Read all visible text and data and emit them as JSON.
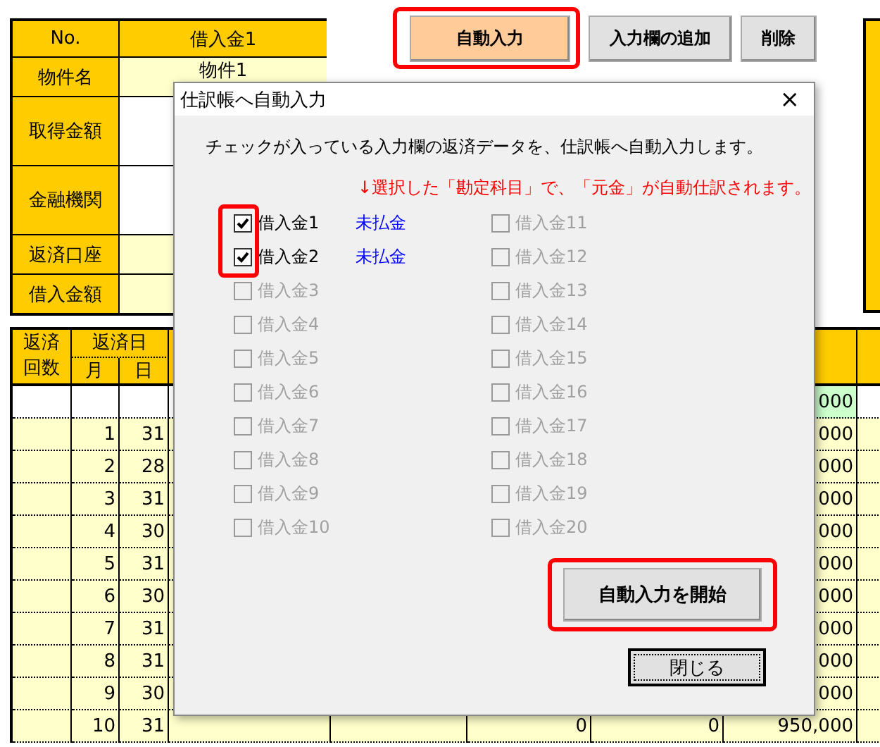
{
  "toolbar": {
    "buttons": [
      {
        "label": "自動入力",
        "kind": "primary",
        "highlighted": true
      },
      {
        "label": "入力欄の追加",
        "kind": "normal",
        "highlighted": false
      },
      {
        "label": "削除",
        "kind": "normal",
        "highlighted": false
      }
    ]
  },
  "info_table": {
    "header": {
      "label": "No.",
      "value": "借入金1"
    },
    "rows": [
      {
        "label": "物件名",
        "value": "物件1",
        "kind": "short"
      },
      {
        "label": "取得金額",
        "kind": "tall"
      },
      {
        "label": "金融機関",
        "kind": "tall"
      },
      {
        "label": "返済口座",
        "kind": "short"
      },
      {
        "label": "借入金額",
        "kind": "short"
      }
    ]
  },
  "schedule": {
    "headers": {
      "count_top": "返済",
      "count_bottom": "回数",
      "date": "返済日",
      "month": "月",
      "day": "日"
    },
    "rows": [
      {
        "kind": "opening",
        "month": "",
        "day": "",
        "column_7": "000"
      },
      {
        "kind": "payment",
        "month": "1",
        "day": "31",
        "column_7": "000"
      },
      {
        "kind": "payment",
        "month": "2",
        "day": "28",
        "column_7": "000"
      },
      {
        "kind": "payment",
        "month": "3",
        "day": "31",
        "column_7": "000"
      },
      {
        "kind": "payment",
        "month": "4",
        "day": "30",
        "column_7": "000"
      },
      {
        "kind": "payment",
        "month": "5",
        "day": "31",
        "column_7": "000"
      },
      {
        "kind": "payment",
        "month": "6",
        "day": "30",
        "column_7": "000"
      },
      {
        "kind": "payment",
        "month": "7",
        "day": "31",
        "column_7": "000"
      },
      {
        "kind": "payment",
        "month": "8",
        "day": "31",
        "column_7": "000"
      },
      {
        "kind": "payment",
        "month": "9",
        "day": "30",
        "column_7": "000"
      },
      {
        "kind": "payment",
        "month": "10",
        "day": "31",
        "column_5": "0",
        "column_6": "0",
        "column_7": "950,000"
      }
    ]
  },
  "dialog": {
    "title": "仕訳帳へ自動入力",
    "close": "×",
    "message": "チェックが入っている入力欄の返済データを、仕訳帳へ自動入力します。",
    "note": "↓選択した「勘定科目」で、「元金」が自動仕訳されます。",
    "items": [
      {
        "label": "借入金1",
        "checked": true,
        "disabled": false,
        "account": "未払金"
      },
      {
        "label": "借入金2",
        "checked": true,
        "disabled": false,
        "account": "未払金"
      },
      {
        "label": "借入金3",
        "checked": false,
        "disabled": true
      },
      {
        "label": "借入金4",
        "checked": false,
        "disabled": true
      },
      {
        "label": "借入金5",
        "checked": false,
        "disabled": true
      },
      {
        "label": "借入金6",
        "checked": false,
        "disabled": true
      },
      {
        "label": "借入金7",
        "checked": false,
        "disabled": true
      },
      {
        "label": "借入金8",
        "checked": false,
        "disabled": true
      },
      {
        "label": "借入金9",
        "checked": false,
        "disabled": true
      },
      {
        "label": "借入金10",
        "checked": false,
        "disabled": true
      },
      {
        "label": "借入金11",
        "checked": false,
        "disabled": true
      },
      {
        "label": "借入金12",
        "checked": false,
        "disabled": true
      },
      {
        "label": "借入金13",
        "checked": false,
        "disabled": true
      },
      {
        "label": "借入金14",
        "checked": false,
        "disabled": true
      },
      {
        "label": "借入金15",
        "checked": false,
        "disabled": true
      },
      {
        "label": "借入金16",
        "checked": false,
        "disabled": true
      },
      {
        "label": "借入金17",
        "checked": false,
        "disabled": true
      },
      {
        "label": "借入金18",
        "checked": false,
        "disabled": true
      },
      {
        "label": "借入金19",
        "checked": false,
        "disabled": true
      },
      {
        "label": "借入金20",
        "checked": false,
        "disabled": true
      }
    ],
    "checked_highlighted": true,
    "start_button": {
      "label": "自動入力を開始",
      "highlighted": true
    },
    "close_button": {
      "label": "閉じる"
    }
  }
}
